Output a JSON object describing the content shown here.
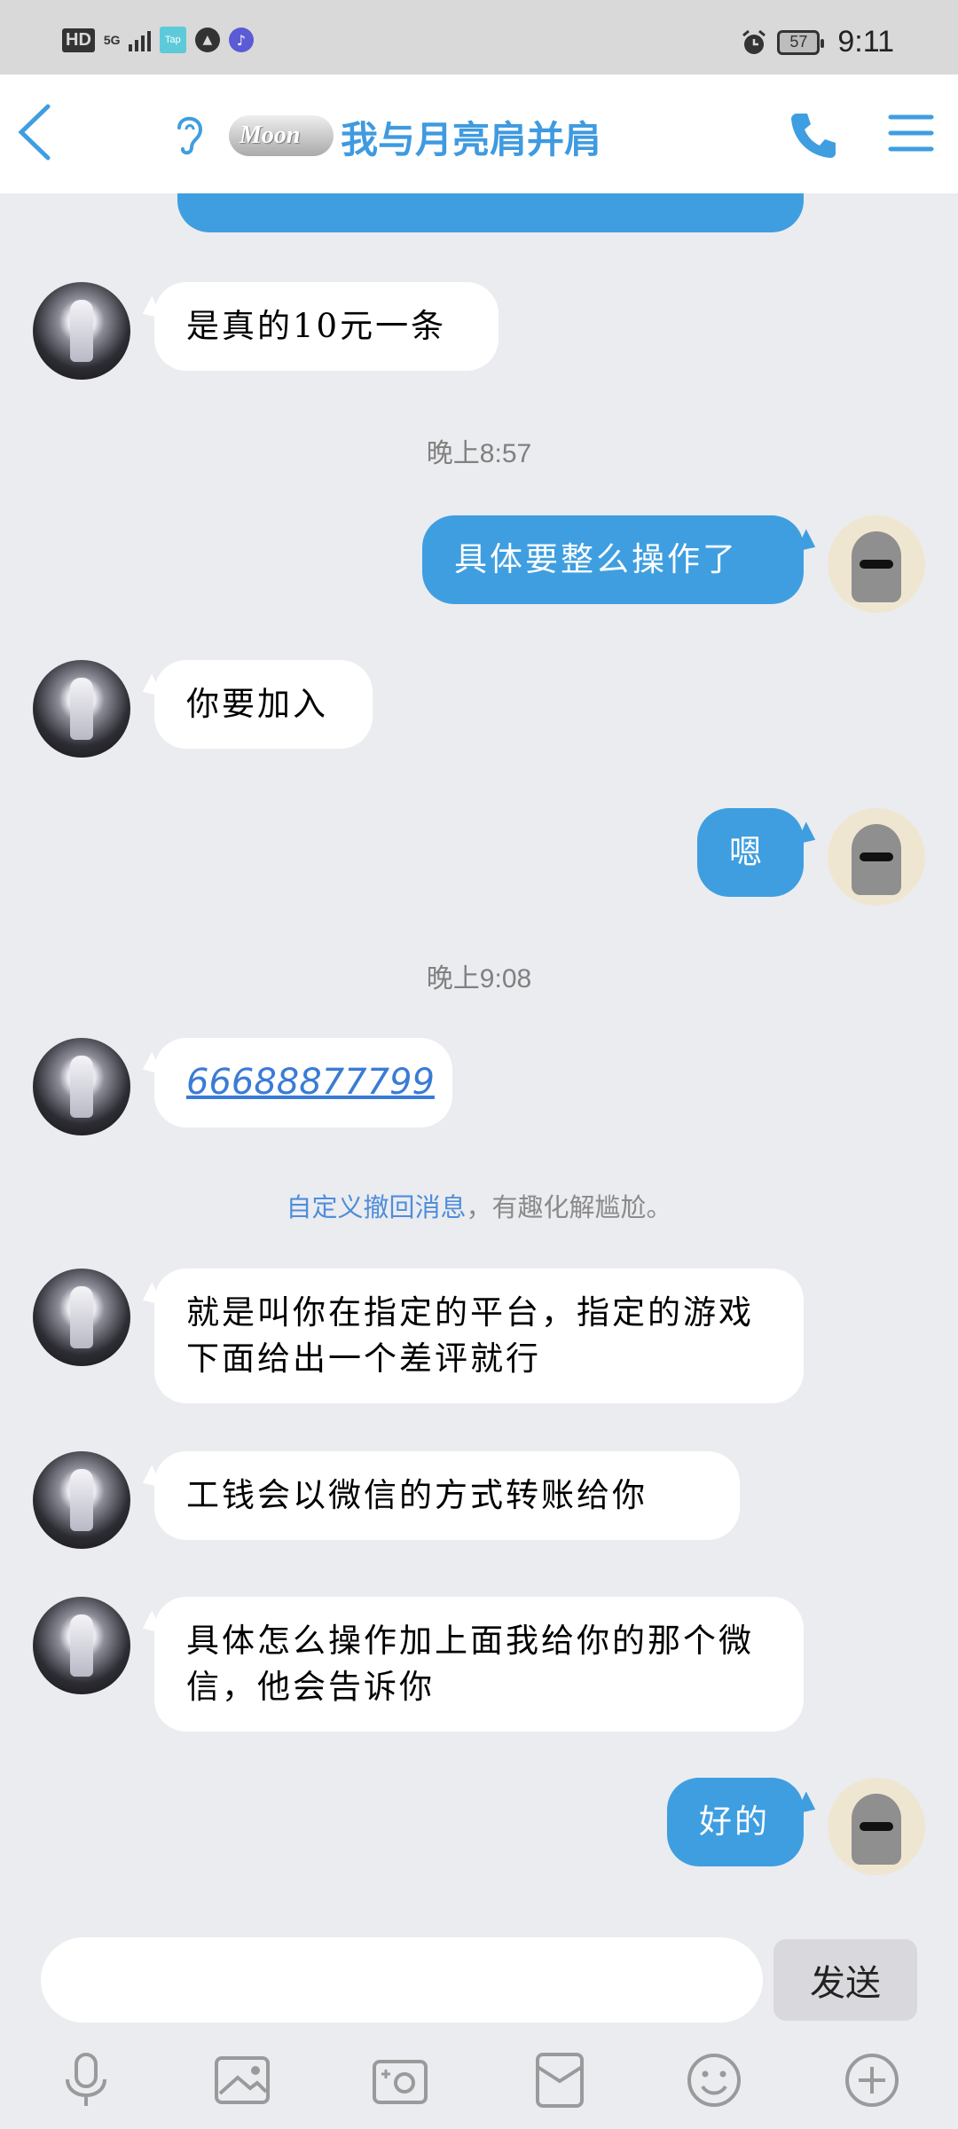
{
  "status_bar": {
    "hd": "HD",
    "network": "5G",
    "tap_label": "Tap",
    "battery": "57",
    "time": "9:11"
  },
  "header": {
    "badge": "Moon",
    "title": "我与月亮肩并肩"
  },
  "messages": [
    {
      "side": "left",
      "text": "是真的10元一条"
    },
    {
      "type": "time",
      "text": "晚上8:57"
    },
    {
      "side": "right",
      "text": "具体要整么操作了"
    },
    {
      "side": "left",
      "text": "你要加入"
    },
    {
      "side": "right",
      "text": "嗯"
    },
    {
      "type": "time",
      "text": "晚上9:08"
    },
    {
      "side": "left",
      "text": "66688877799",
      "link": true
    },
    {
      "type": "system",
      "link_text": "自定义撤回消息",
      "text": "，有趣化解尴尬。"
    },
    {
      "side": "left",
      "text": "就是叫你在指定的平台，指定的游戏下面给出一个差评就行"
    },
    {
      "side": "left",
      "text": "工钱会以微信的方式转账给你"
    },
    {
      "side": "left",
      "text": "具体怎么操作加上面我给你的那个微信，他会告诉你"
    },
    {
      "side": "right",
      "text": "好的"
    }
  ],
  "input": {
    "value": "",
    "send_label": "发送"
  },
  "toolbar": [
    "microphone-icon",
    "image-icon",
    "camera-icon",
    "red-packet-icon",
    "emoji-icon",
    "plus-icon"
  ],
  "colors": {
    "accent": "#3f9ee0",
    "background": "#ebecf0",
    "link": "#4f8ddb"
  }
}
